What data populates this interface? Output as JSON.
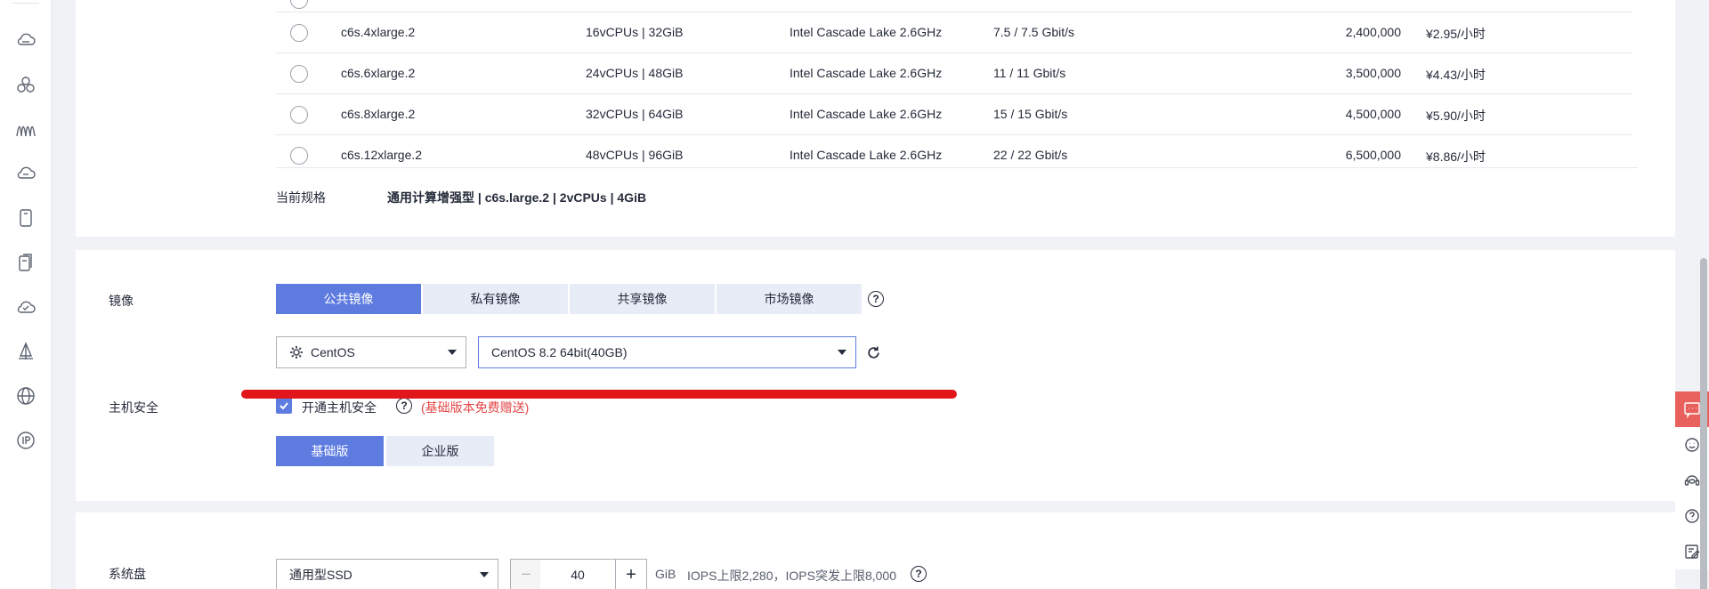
{
  "spec_table": {
    "rows": [
      {
        "name": "c6s.4xlarge.2",
        "vcpu_mem": "16vCPUs | 32GiB",
        "processor": "Intel Cascade Lake 2.6GHz",
        "bandwidth": "7.5 / 7.5 Gbit/s",
        "pps": "2,400,000",
        "price": "¥2.95/小时"
      },
      {
        "name": "c6s.6xlarge.2",
        "vcpu_mem": "24vCPUs | 48GiB",
        "processor": "Intel Cascade Lake 2.6GHz",
        "bandwidth": "11 / 11 Gbit/s",
        "pps": "3,500,000",
        "price": "¥4.43/小时"
      },
      {
        "name": "c6s.8xlarge.2",
        "vcpu_mem": "32vCPUs | 64GiB",
        "processor": "Intel Cascade Lake 2.6GHz",
        "bandwidth": "15 / 15 Gbit/s",
        "pps": "4,500,000",
        "price": "¥5.90/小时"
      },
      {
        "name": "c6s.12xlarge.2",
        "vcpu_mem": "48vCPUs | 96GiB",
        "processor": "Intel Cascade Lake 2.6GHz",
        "bandwidth": "22 / 22 Gbit/s",
        "pps": "6,500,000",
        "price": "¥8.86/小时"
      }
    ],
    "current_label": "当前规格",
    "current_value": "通用计算增强型 | c6s.large.2 | 2vCPUs | 4GiB"
  },
  "image": {
    "label": "镜像",
    "tabs": [
      "公共镜像",
      "私有镜像",
      "共享镜像",
      "市场镜像"
    ],
    "active_tab": 0,
    "help": "?",
    "os_select": "CentOS",
    "version_select": "CentOS 8.2 64bit(40GB)"
  },
  "host_security": {
    "label": "主机安全",
    "checkbox_label": "开通主机安全",
    "checked": true,
    "help": "?",
    "note": "(基础版本免费赠送)",
    "editions": [
      "基础版",
      "企业版"
    ],
    "active_edition": 0
  },
  "system_disk": {
    "label": "系统盘",
    "type": "通用型SSD",
    "size": "40",
    "minus": "−",
    "plus": "+",
    "unit": "GiB",
    "iops": "IOPS上限2,280，IOPS突发上限8,000",
    "help": "?"
  },
  "colors": {
    "primary": "#5e7ce0",
    "tab_inactive": "#e8ecf7",
    "annotation_red": "#e0161b",
    "note_red": "#e54545",
    "float_active": "#e8615c"
  },
  "rail_icons": [
    "cloud-server-icon",
    "cluster-icon",
    "network-icon",
    "database-icon",
    "disk-icon",
    "backup-icon",
    "cloud-upload-icon",
    "deploy-icon",
    "globe-icon",
    "ip-icon"
  ],
  "float_icons": [
    "chat-icon",
    "smile-icon",
    "headset-icon",
    "help-icon",
    "feedback-icon"
  ]
}
